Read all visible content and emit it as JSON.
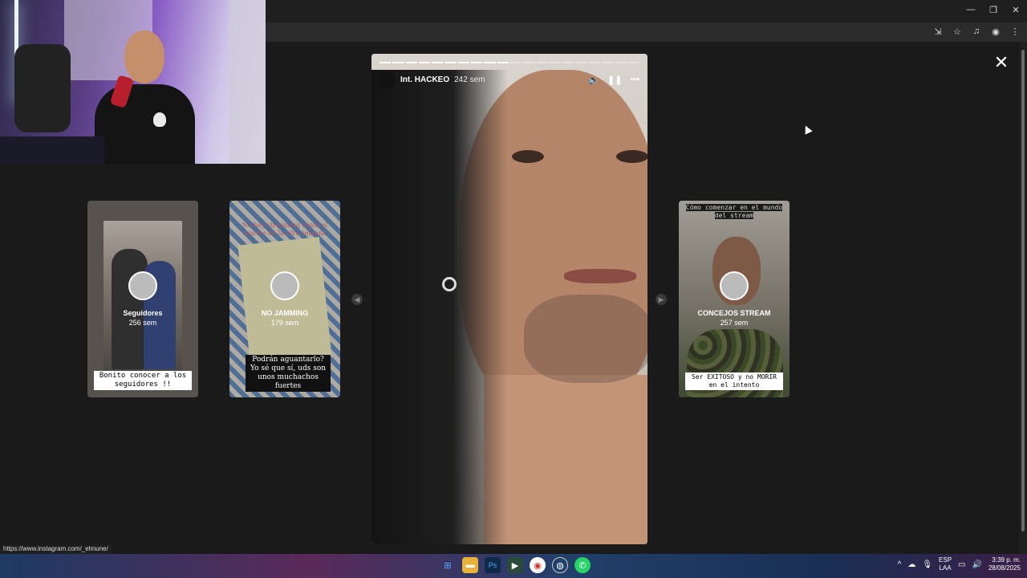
{
  "window": {
    "controls": [
      "—",
      "❐",
      "✕"
    ]
  },
  "toolbar": {
    "icons": [
      "install-icon",
      "star-icon",
      "media-icon",
      "profile-icon",
      "menu-icon"
    ]
  },
  "stories": {
    "main": {
      "username": "Int. HACKEO",
      "time": "242 sem",
      "progress_segments": 20,
      "progress_done": 10
    },
    "cards": [
      {
        "name": "Seguidores",
        "age": "256 sem",
        "bottom_caption": "Bonito conocer a los seguidores !!"
      },
      {
        "name": "NO JAMMING",
        "age": "179 sem",
        "top_caption": "No hay streaming hasta el martes de la otra semana",
        "bottom_caption": "Podrán aguantarlo? Yo sé que sí, uds son unos muchachos fuertes"
      },
      {
        "name": "CONCEJOS STREAM",
        "age": "257 sem",
        "top_caption": "Cómo comenzar en el mundo del stream",
        "bottom_caption": "Ser EXITOSO y no MORIR en el intento"
      }
    ],
    "close_label": "✕"
  },
  "status": {
    "url": "https://www.instagram.com/_elmune/"
  },
  "taskbar": {
    "lang_top": "ESP",
    "lang_bottom": "LAA",
    "time": "3:39 p. m.",
    "date": "28/08/2025"
  }
}
